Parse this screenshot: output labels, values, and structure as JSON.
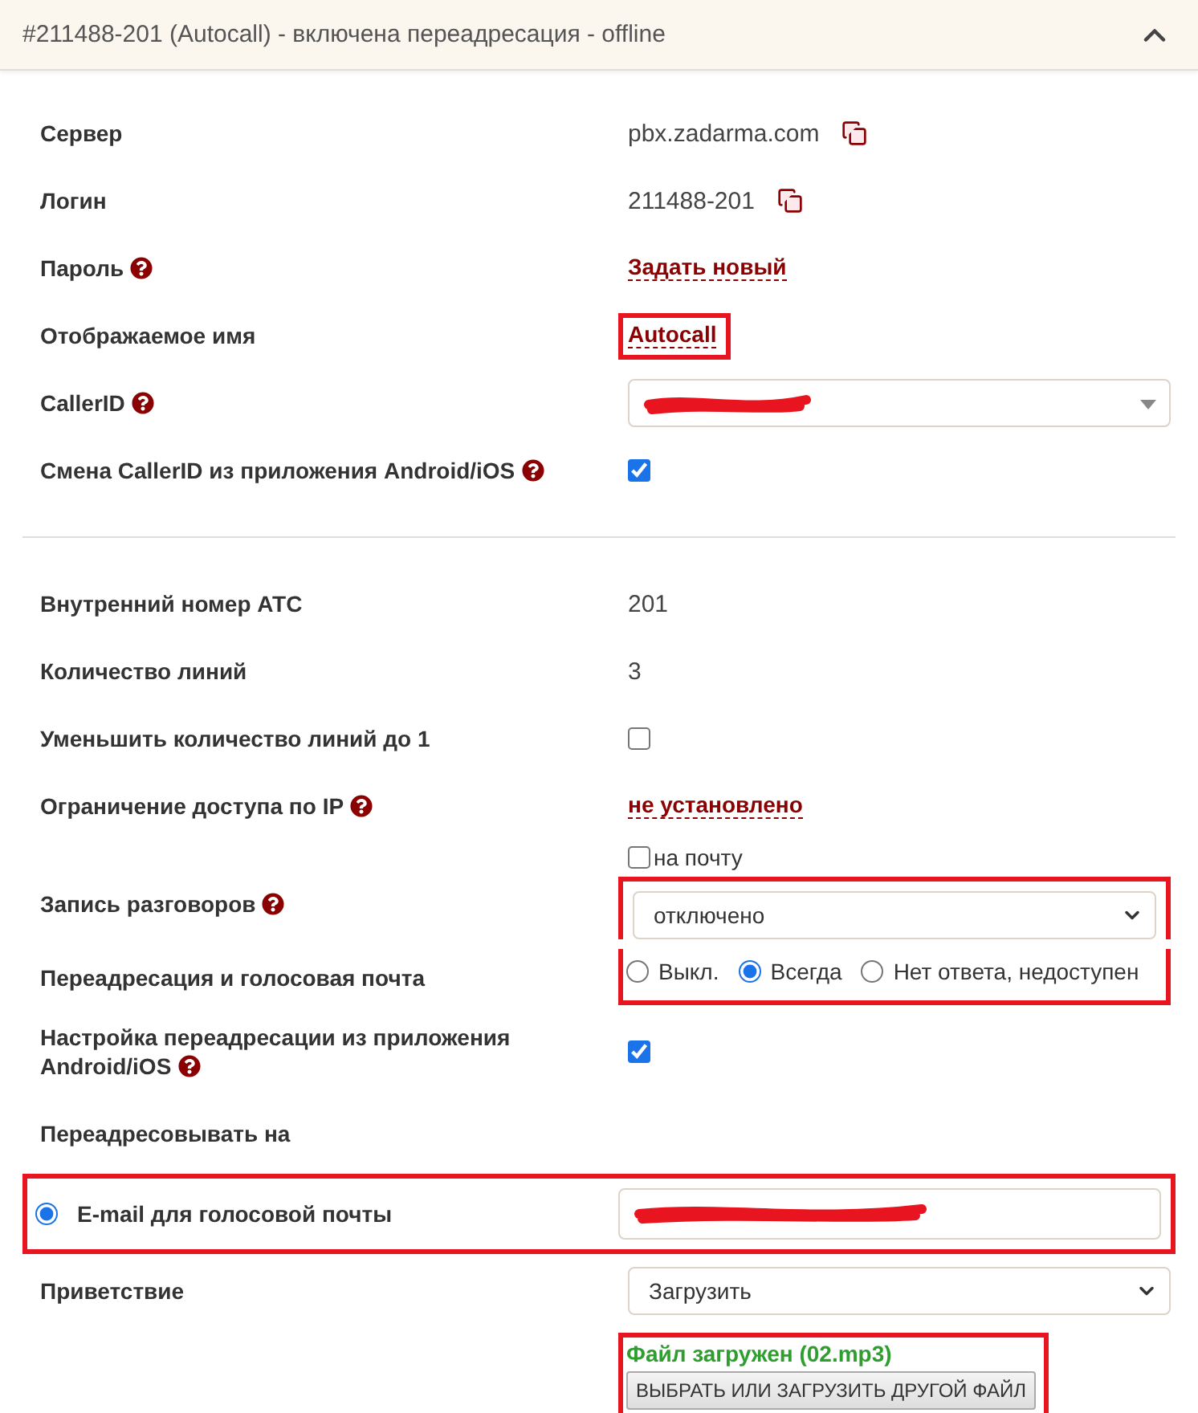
{
  "header": {
    "title": "#211488-201 (Autocall) - включена переадресация - offline",
    "expanded": true
  },
  "rows": [
    {
      "kind": "copy",
      "label": "Сервер",
      "help": false,
      "value": "pbx.zadarma.com"
    },
    {
      "kind": "copy",
      "label": "Логин",
      "help": false,
      "value": "211488-201"
    },
    {
      "kind": "link",
      "label": "Пароль",
      "help": true,
      "value": "Задать новый",
      "highlighted": false
    },
    {
      "kind": "link",
      "label": "Отображаемое имя",
      "help": false,
      "value": "Autocall",
      "highlighted": true
    },
    {
      "kind": "dropdown",
      "label": "CallerID",
      "help": true,
      "redacted": true
    },
    {
      "kind": "checkbox",
      "label": "Смена CallerID из приложения Android/iOS",
      "help": true,
      "checked": true
    },
    {
      "kind": "divider"
    },
    {
      "kind": "text",
      "label": "Внутренний номер АТС",
      "help": false,
      "value": "201"
    },
    {
      "kind": "text",
      "label": "Количество линий",
      "help": false,
      "value": "3"
    },
    {
      "kind": "checkbox",
      "label": "Уменьшить количество линий до 1",
      "help": false,
      "checked": false
    },
    {
      "kind": "link",
      "label": "Ограничение доступа по IP",
      "help": true,
      "value": "не установлено",
      "highlighted": false
    },
    {
      "kind": "recording",
      "label": "Запись разговоров",
      "help": true,
      "option": {
        "label": "на почту",
        "checked": false
      },
      "value": "отключено",
      "highlighted": true
    },
    {
      "kind": "radios",
      "label": "Переадресация и голосовая почта",
      "help": false,
      "highlighted": true,
      "options": [
        {
          "label": "Выкл.",
          "selected": false
        },
        {
          "label": "Всегда",
          "selected": true
        },
        {
          "label": "Нет ответа, недоступен",
          "selected": false
        }
      ]
    },
    {
      "kind": "checkbox",
      "label": "Настройка переадресации из приложения Android/iOS",
      "help": true,
      "checked": true
    },
    {
      "kind": "heading",
      "label": "Переадресовывать на",
      "help": false
    },
    {
      "kind": "email",
      "label": "E-mail для голосовой почты",
      "selected": true,
      "redacted": true,
      "highlighted": true
    },
    {
      "kind": "select",
      "label": "Приветствие",
      "help": false,
      "value": "Загрузить"
    },
    {
      "kind": "file",
      "status": "Файл загружен (02.mp3)",
      "button": "ВЫБРАТЬ ИЛИ ЗАГРУЗИТЬ ДРУГОЙ ФАЙЛ",
      "highlighted": true
    }
  ]
}
